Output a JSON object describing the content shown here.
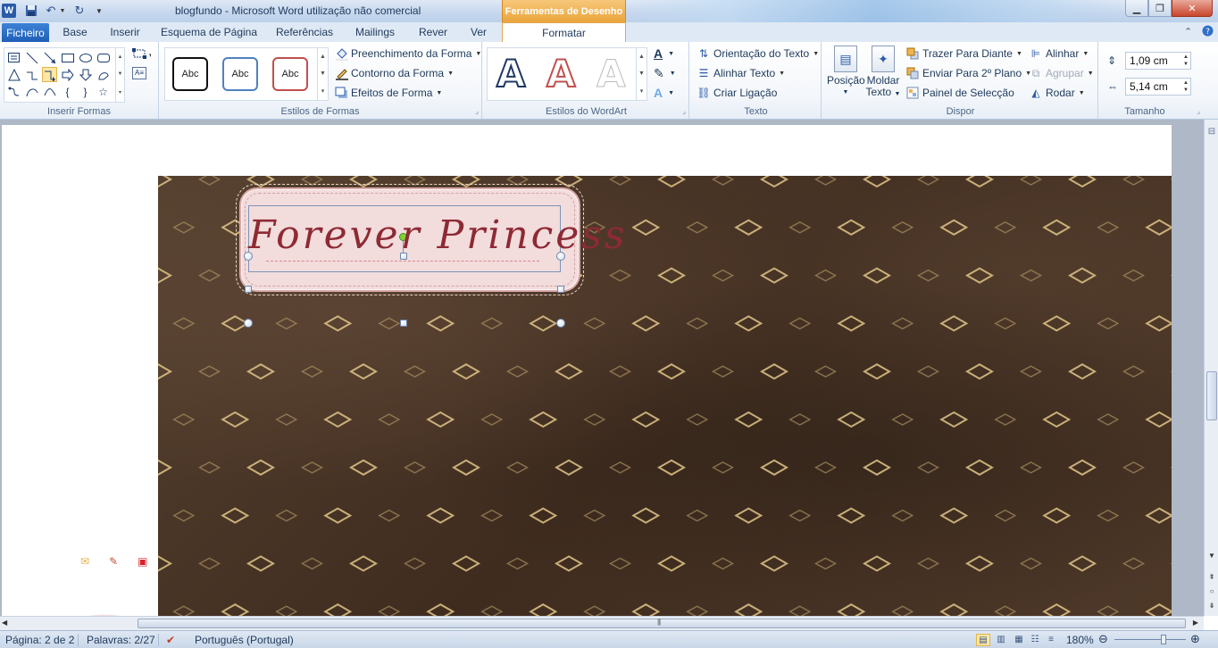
{
  "window": {
    "title": "blogfundo  -  Microsoft Word utilização não comercial",
    "context_header": "Ferramentas de Desenho"
  },
  "quick_access": {
    "app_icon": "word-icon",
    "save_icon": "save-icon",
    "undo_icon": "undo-icon",
    "redo_icon": "redo-icon"
  },
  "tabs": [
    {
      "label": "Ficheiro"
    },
    {
      "label": "Base"
    },
    {
      "label": "Inserir"
    },
    {
      "label": "Esquema de Página"
    },
    {
      "label": "Referências"
    },
    {
      "label": "Mailings"
    },
    {
      "label": "Rever"
    },
    {
      "label": "Ver"
    },
    {
      "label": "Formatar"
    }
  ],
  "ribbon": {
    "insert_shapes": {
      "label": "Inserir Formas"
    },
    "shape_styles": {
      "label": "Estilos de Formas",
      "swatches": [
        "Abc",
        "Abc",
        "Abc"
      ],
      "fill": "Preenchimento da Forma",
      "outline": "Contorno da Forma",
      "effects": "Efeitos de Forma"
    },
    "wordart": {
      "label": "Estilos do WordArt",
      "letters": [
        "A",
        "A",
        "A"
      ],
      "text_fill_letter": "A",
      "text_effects_letter": "A"
    },
    "text": {
      "label": "Texto",
      "direction": "Orientação do Texto",
      "align": "Alinhar Texto",
      "link": "Criar Ligação"
    },
    "arrange": {
      "label": "Dispor",
      "position_label": "Posição",
      "wrap_label_1": "Moldar",
      "wrap_label_2": "Texto",
      "bring_forward": "Trazer Para Diante",
      "send_backward": "Enviar Para 2º Plano",
      "selection_pane": "Painel de Selecção",
      "align": "Alinhar",
      "group": "Agrupar",
      "rotate": "Rodar"
    },
    "size": {
      "label": "Tamanho",
      "height": "1,09 cm",
      "width": "5,14 cm"
    }
  },
  "document": {
    "label_title": "Forever Princess",
    "label_fill": "#f2dcdc",
    "title_color": "#8e2a34",
    "background_color": "#4b3526"
  },
  "status_bar": {
    "page": "Página: 2 de 2",
    "words": "Palavras: 2/27",
    "language": "Português (Portugal)",
    "zoom": "180%"
  }
}
